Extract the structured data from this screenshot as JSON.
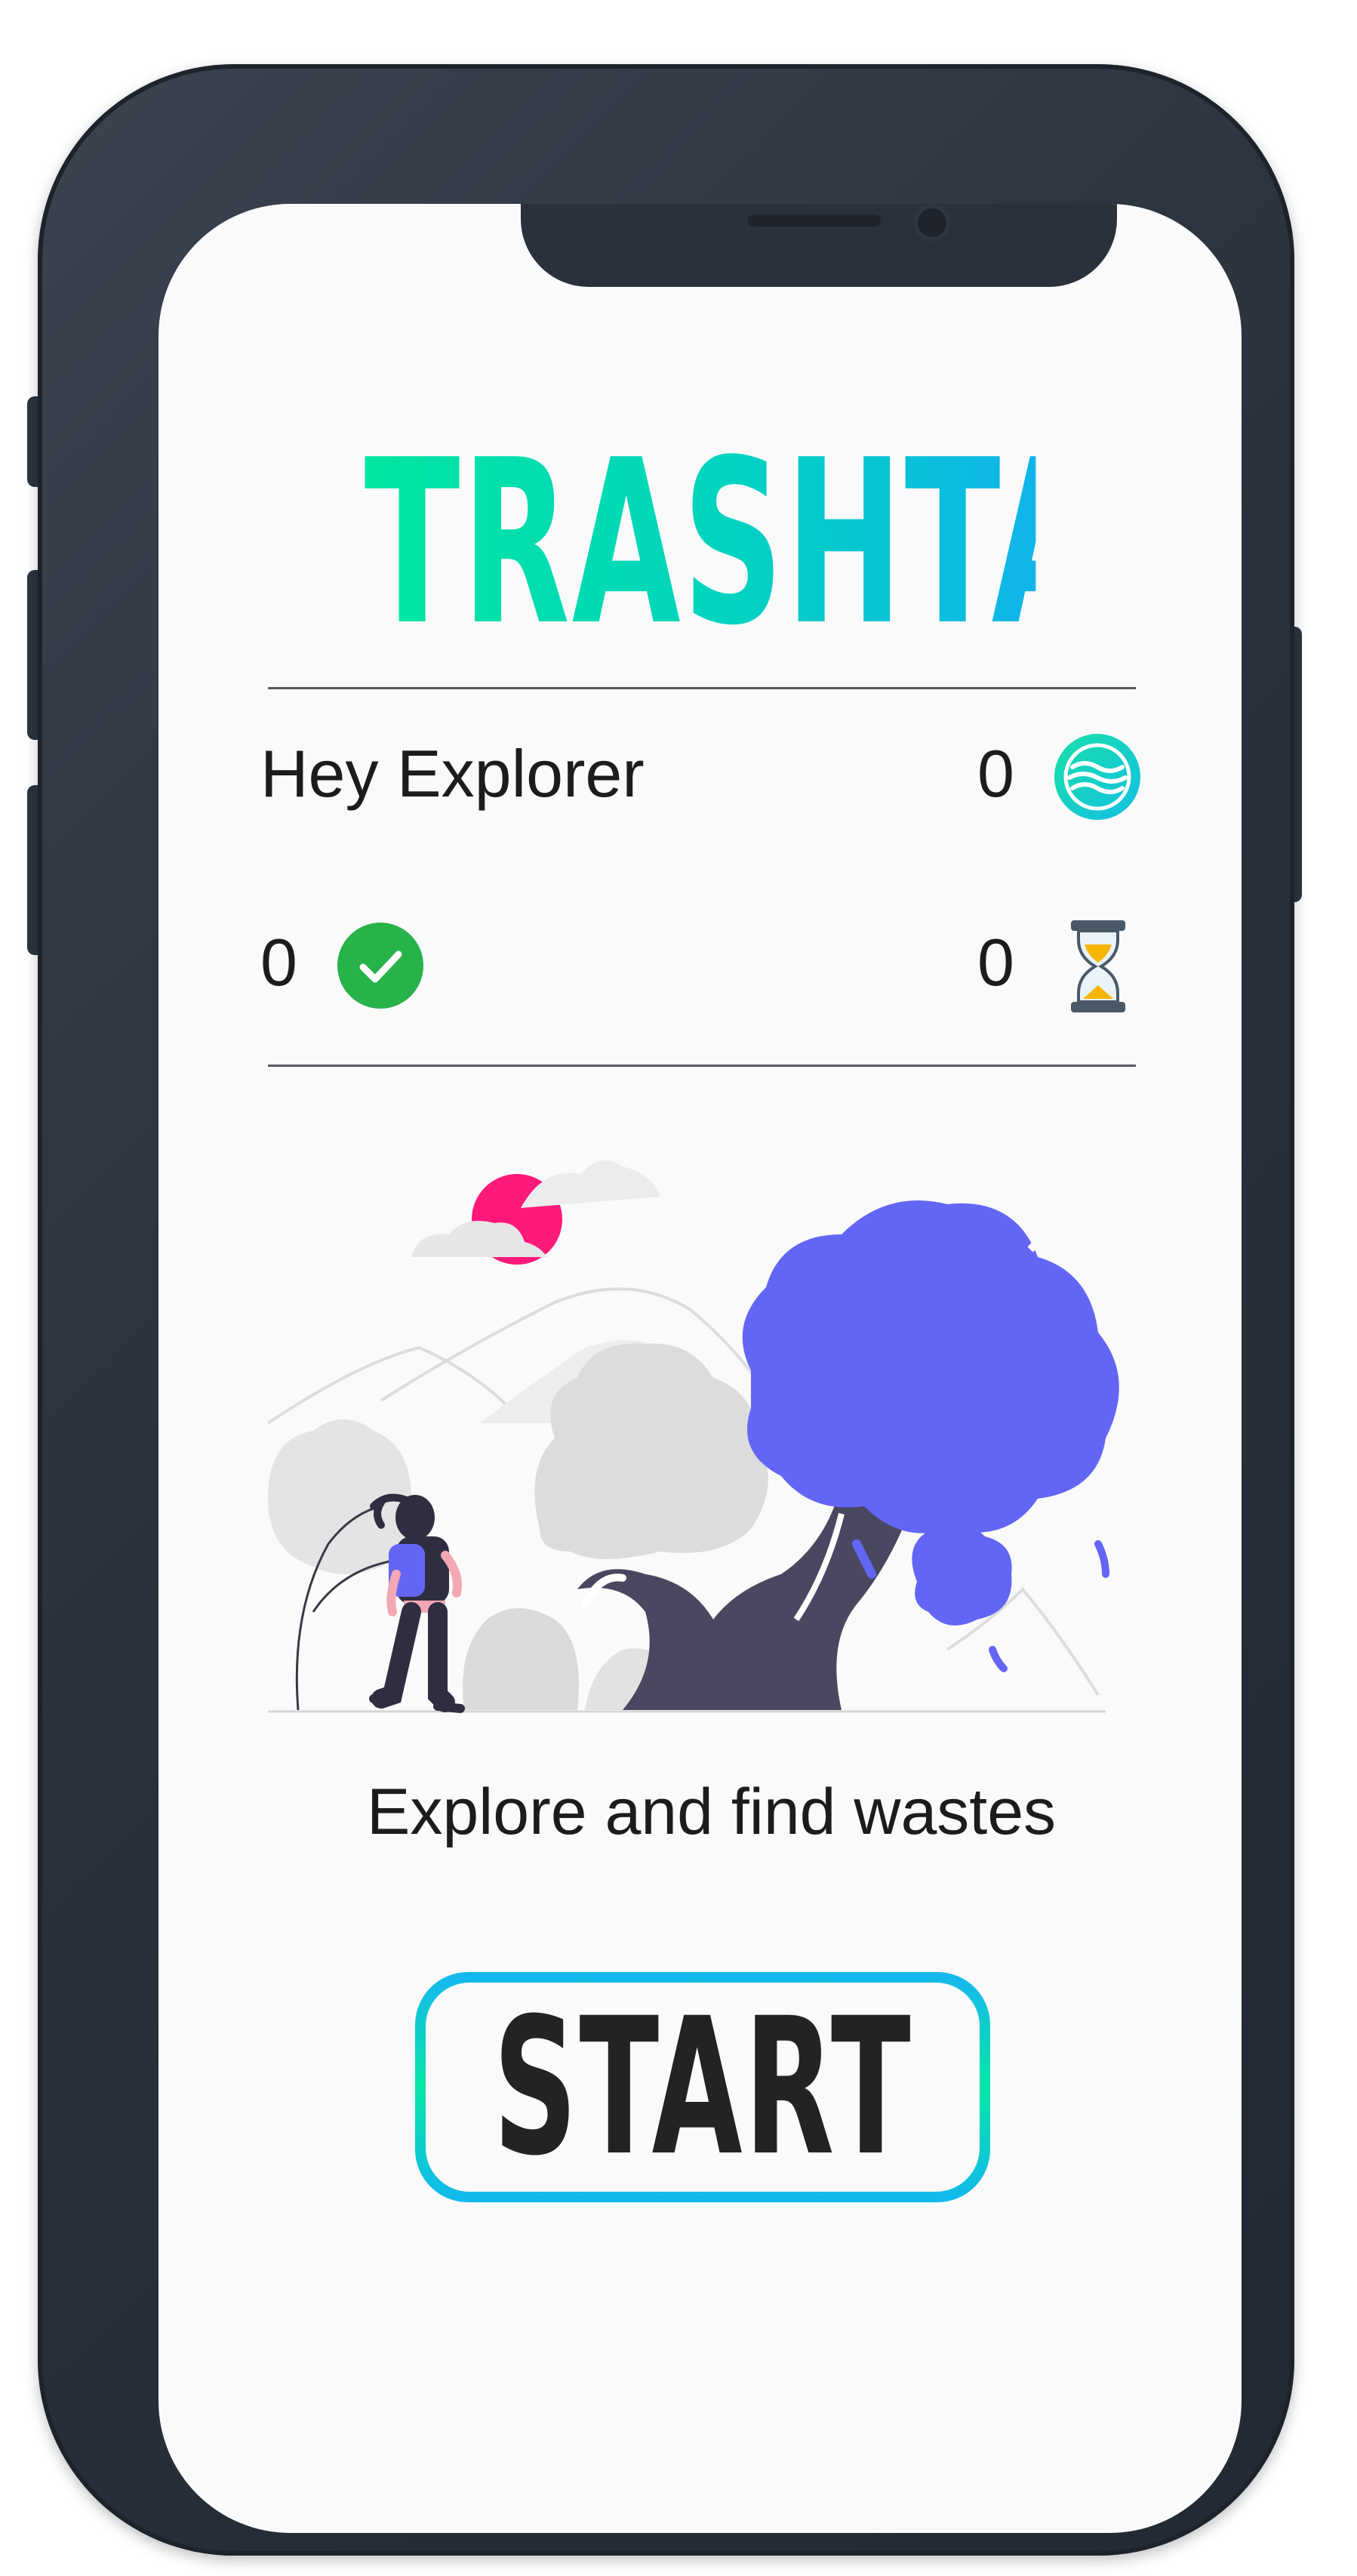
{
  "app": {
    "title": "TRASHTAG"
  },
  "status": {
    "greeting": "Hey Explorer",
    "points_count": "0",
    "completed_count": "0",
    "pending_count": "0"
  },
  "main": {
    "caption": "Explore and find wastes",
    "start_label": "START"
  },
  "icons": {
    "points": "waves-coin-icon",
    "completed": "check-circle-icon",
    "pending": "hourglass-icon"
  },
  "colors": {
    "title_gradient_start": "#00e6a0",
    "title_gradient_end": "#10b4ea",
    "check_green": "#27b24a",
    "tree_purple": "#6366f5",
    "sun_pink": "#ff1a7a",
    "phone_frame": "#2d3440"
  }
}
